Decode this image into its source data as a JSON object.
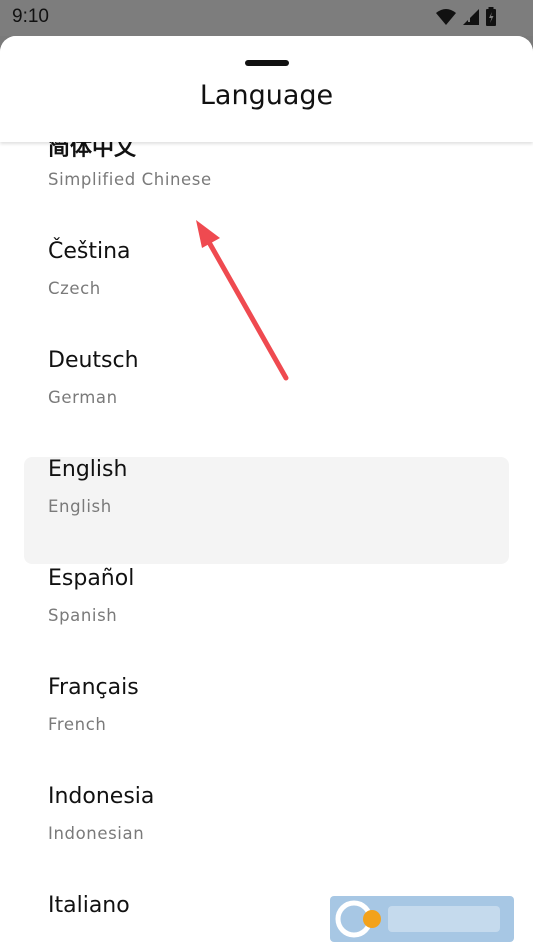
{
  "status_bar": {
    "time": "9:10",
    "icons": [
      "wifi-icon",
      "signal-icon",
      "battery-icon"
    ]
  },
  "sheet": {
    "title": "Language"
  },
  "languages": [
    {
      "native": "简体中文",
      "english": "Simplified Chinese",
      "selected": false
    },
    {
      "native": "Čeština",
      "english": "Czech",
      "selected": false
    },
    {
      "native": "Deutsch",
      "english": "German",
      "selected": false
    },
    {
      "native": "English",
      "english": "English",
      "selected": true
    },
    {
      "native": "Español",
      "english": "Spanish",
      "selected": false
    },
    {
      "native": "Français",
      "english": "French",
      "selected": false
    },
    {
      "native": "Indonesia",
      "english": "Indonesian",
      "selected": false
    },
    {
      "native": "Italiano",
      "english": "",
      "selected": false
    }
  ],
  "colors": {
    "selected_bg": "#f4f4f4",
    "annotation_arrow": "#ef4a50",
    "secondary_text": "#7a7a7a"
  }
}
